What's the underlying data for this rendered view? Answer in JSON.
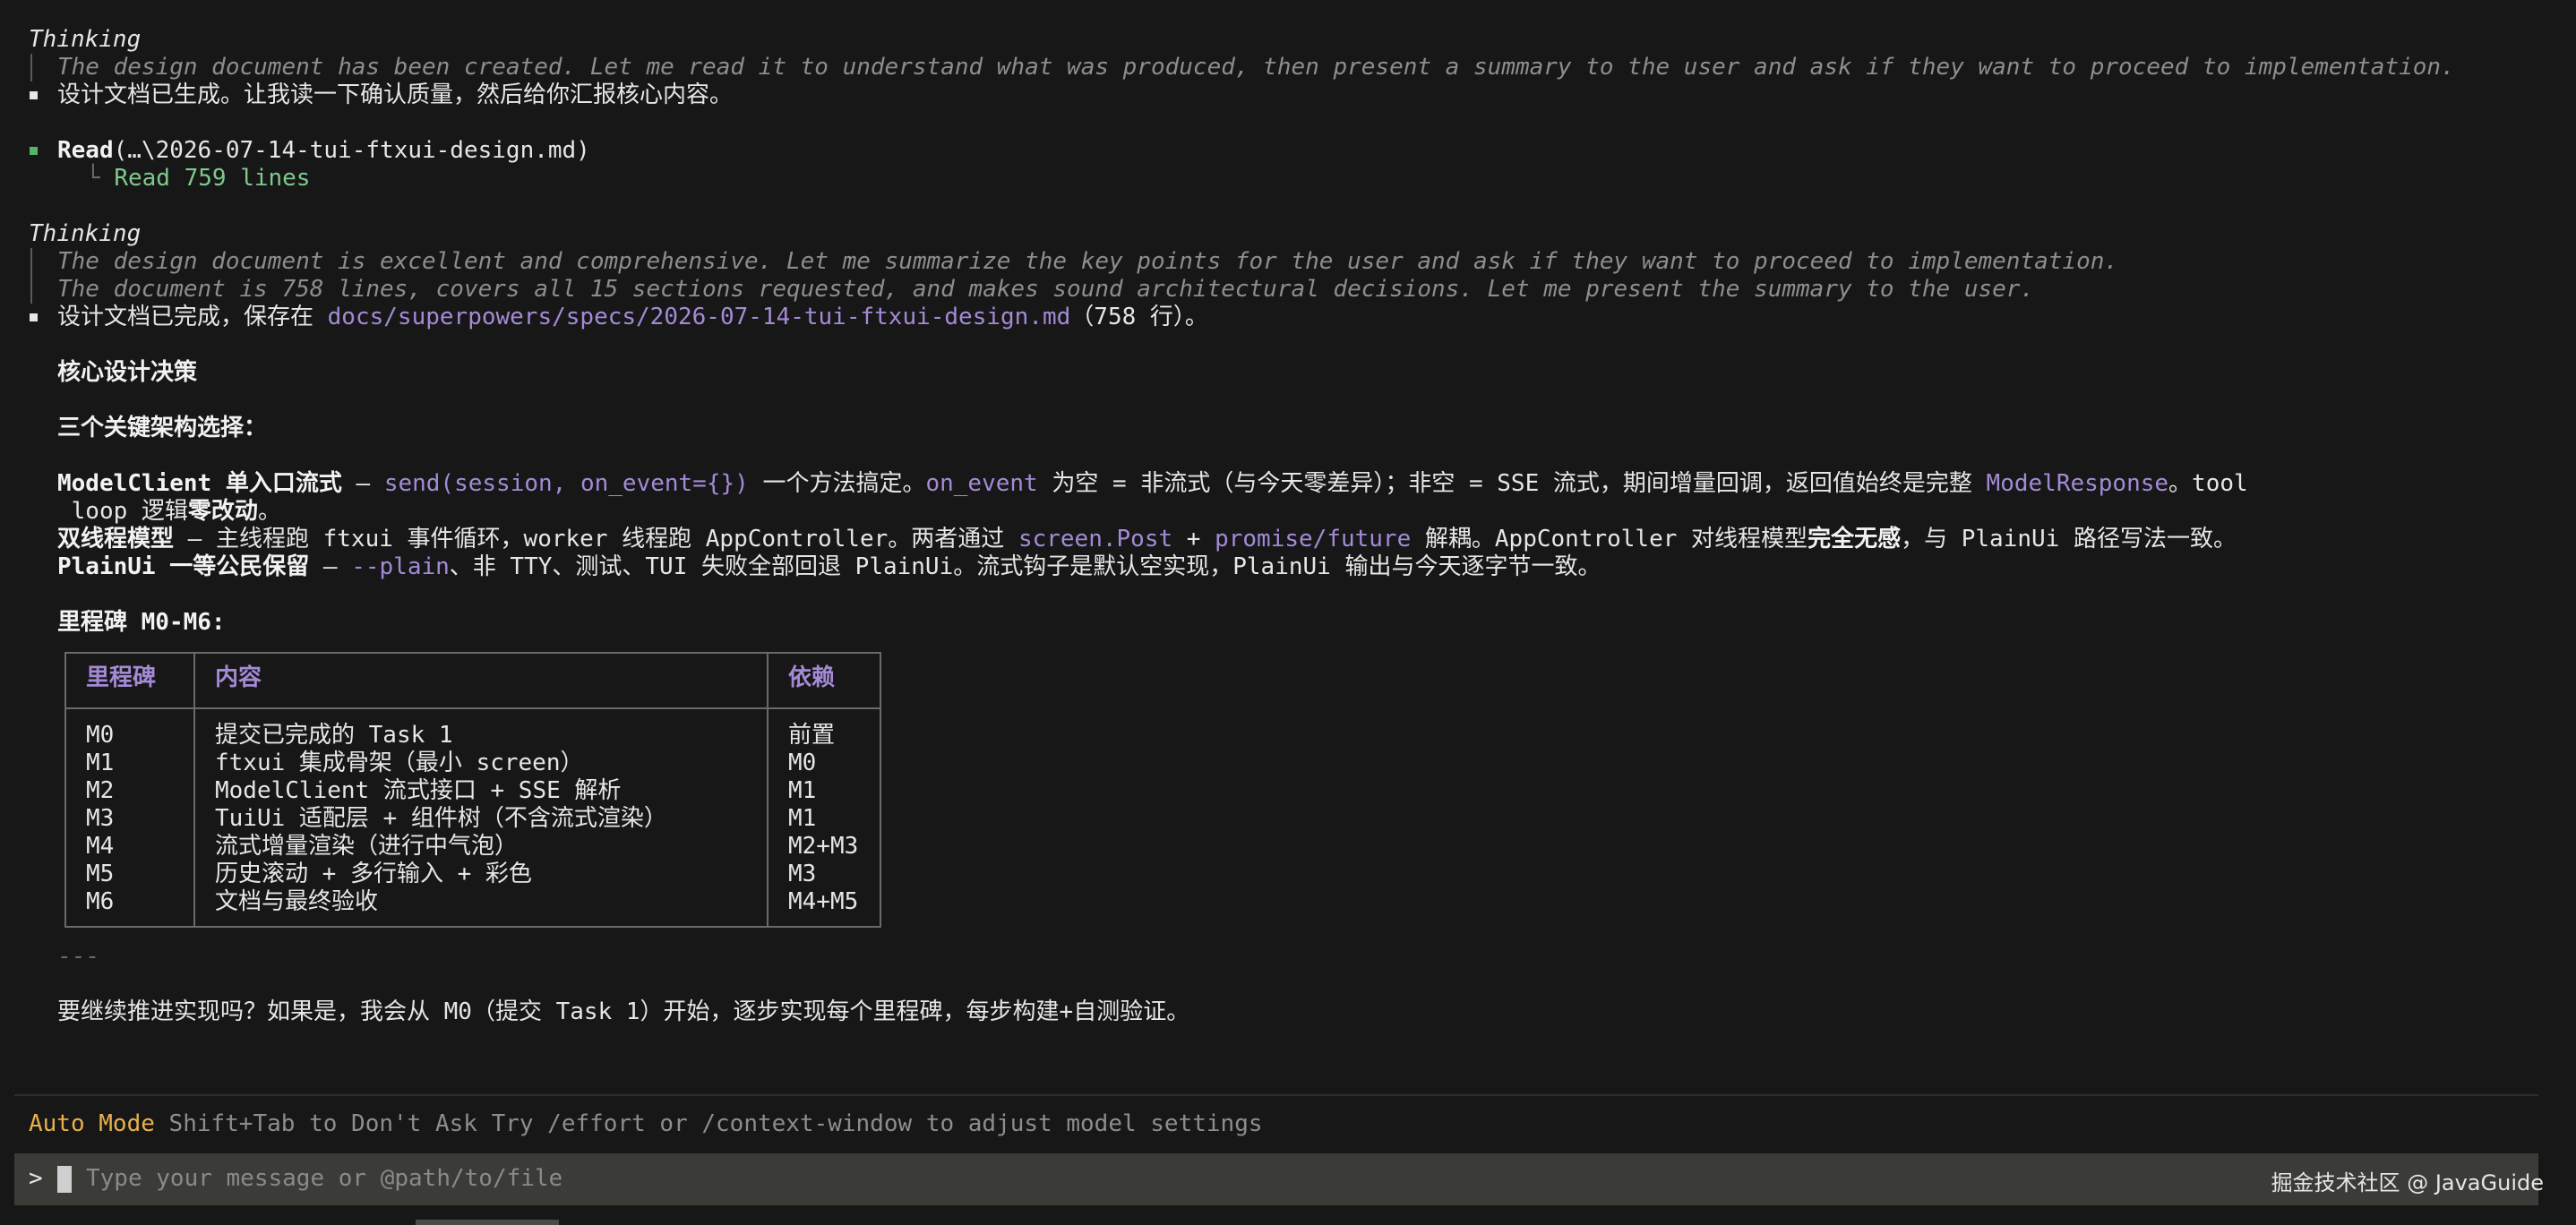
{
  "thinking_1": {
    "label": "Thinking",
    "lines": [
      "The design document has been created. Let me read it to understand what was produced, then present a summary to the user and ask if they want to proceed to implementation."
    ]
  },
  "message_1": "设计文档已生成。让我读一下确认质量，然后给你汇报核心内容。",
  "tool_call": {
    "name": "Read",
    "args": "(…\\2026-07-14-tui-ftxui-design.md)",
    "branch": "└",
    "result": "Read 759 lines"
  },
  "thinking_2": {
    "label": "Thinking",
    "lines": [
      "The design document is excellent and comprehensive. Let me summarize the key points for the user and ask if they want to proceed to implementation.",
      "The document is 758 lines, covers all 15 sections requested, and makes sound architectural decisions. Let me present the summary to the user."
    ]
  },
  "message_2": {
    "prefix": "设计文档已完成，保存在 ",
    "path": "docs/superpowers/specs/2026-07-14-tui-ftxui-design.md",
    "suffix": "（758 行）。"
  },
  "section_heading": "核心设计决策",
  "subheading": "三个关键架构选择：",
  "decision_1": {
    "title": "ModelClient 单入口流式",
    "dash": " — ",
    "code_1": "send(session, on_event={})",
    "text_1": " 一个方法搞定。",
    "code_2": "on_event",
    "text_2": " 为空 = 非流式（与今天零差异）；非空 = SSE 流式，期间增量回调，返回值始终是完整 ",
    "code_3": "ModelResponse",
    "text_3": "。tool",
    "line2_text": " loop 逻辑",
    "line2_bold": "零改动",
    "line2_end": "。"
  },
  "decision_2": {
    "title": "双线程模型",
    "text_1": " — 主线程跑 ftxui 事件循环，worker 线程跑 AppController。两者通过 ",
    "code_1": "screen.Post",
    "text_2": " + ",
    "code_2": "promise/future",
    "text_3": " 解耦。AppController 对线程模型",
    "bold": "完全无感",
    "text_4": "，与 PlainUi 路径写法一致。"
  },
  "decision_3": {
    "title": "PlainUi 一等公民保留",
    "dash": " — ",
    "code_1": "--plain",
    "text_1": "、非 TTY、测试、TUI 失败全部回退 PlainUi。流式钩子是默认空实现，PlainUi 输出与今天逐字节一致。"
  },
  "milestone_heading": "里程碑 M0-M6:",
  "milestones": {
    "headers": [
      "里程碑",
      "内容",
      "依赖"
    ],
    "rows": [
      {
        "id": "M0",
        "content": "提交已完成的 Task 1",
        "deps": "前置"
      },
      {
        "id": "M1",
        "content": "ftxui 集成骨架（最小 screen）",
        "deps": "M0"
      },
      {
        "id": "M2",
        "content": "ModelClient 流式接口 + SSE 解析",
        "deps": "M1"
      },
      {
        "id": "M3",
        "content": "TuiUi 适配层 + 组件树（不含流式渲染）",
        "deps": "M1"
      },
      {
        "id": "M4",
        "content": "流式增量渲染（进行中气泡）",
        "deps": "M2+M3"
      },
      {
        "id": "M5",
        "content": "历史滚动 + 多行输入 + 彩色",
        "deps": "M3"
      },
      {
        "id": "M6",
        "content": "文档与最终验收",
        "deps": "M4+M5"
      }
    ]
  },
  "hr": "---",
  "closing_question": "要继续推进实现吗？如果是，我会从 M0（提交 Task 1）开始，逐步实现每个里程碑，每步构建+自测验证。",
  "status_bar": {
    "mode": "Auto Mode",
    "hint": " Shift+Tab to Don't Ask Try /effort or /context-window to adjust model settings"
  },
  "input": {
    "prompt": ">",
    "placeholder": "Type your message or @path/to/file"
  },
  "watermark": "掘金技术社区 @ JavaGuide",
  "colors": {
    "background": "#171717",
    "text": "#e6e6e6",
    "muted": "#8d8d8d",
    "accent_purple": "#a48ad6",
    "accent_green": "#7ec98d",
    "auto_mode": "#e9b04c",
    "input_bg": "#3b3b38"
  }
}
